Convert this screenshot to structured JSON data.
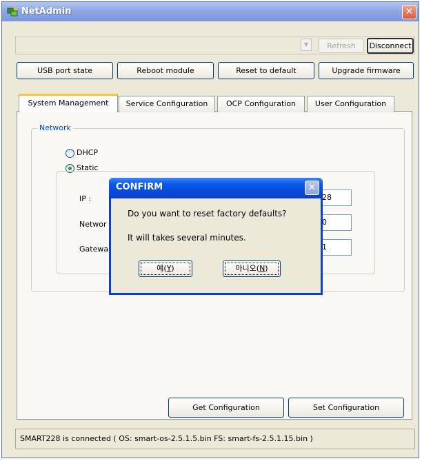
{
  "window": {
    "title": "NetAdmin",
    "close_glyph": "✕"
  },
  "toolbar": {
    "refresh_label": "Refresh",
    "disconnect_label": "Disconnect",
    "combo_arrow": "▼"
  },
  "actions": {
    "usb_port_state": "USB port state",
    "reboot_module": "Reboot module",
    "reset_to_default": "Reset to default",
    "upgrade_firmware": "Upgrade firmware"
  },
  "tabs": [
    {
      "label": "System Management",
      "active": true
    },
    {
      "label": "Service Configuration",
      "active": false
    },
    {
      "label": "OCP Configuration",
      "active": false
    },
    {
      "label": "User Configuration",
      "active": false
    }
  ],
  "network": {
    "group_label": "Network",
    "dhcp_label": "DHCP",
    "static_label": "Static",
    "selected": "Static",
    "ip_label": "IP :",
    "netmask_label_visible": "Networ",
    "gateway_label_visible": "Gatewa",
    "ip_value_visible": "28",
    "netmask_value_visible": "0",
    "gateway_value_visible": "1"
  },
  "footer": {
    "get_configuration": "Get Configuration",
    "set_configuration": "Set Configuration"
  },
  "status": {
    "text": "SMART228 is connected ( OS: smart-os-2.5.1.5.bin  FS: smart-fs-2.5.1.15.bin )"
  },
  "dialog": {
    "title": "CONFIRM",
    "close_glyph": "✕",
    "message_line1": "Do you want to reset factory defaults?",
    "message_line2": "It will takes several minutes.",
    "yes_text": "예(",
    "yes_mnemonic": "Y",
    "no_text": "아니오(",
    "no_mnemonic": "N",
    "close_paren": ")"
  },
  "colors": {
    "titlebar": "#8ea8e6",
    "dialog_titlebar": "#0a5ae8",
    "group_label": "#0046d5",
    "active_tab_accent": "#ffc83c"
  }
}
